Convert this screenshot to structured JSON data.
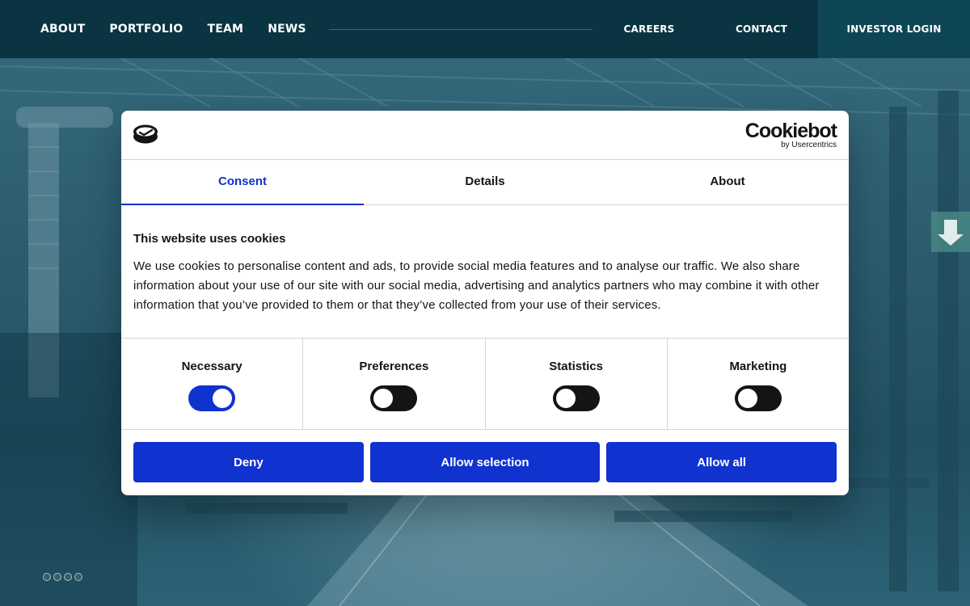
{
  "nav": {
    "left": [
      "ABOUT",
      "PORTFOLIO",
      "TEAM",
      "NEWS"
    ],
    "careers": "CAREERS",
    "contact": "CONTACT",
    "investor_login": "INVESTOR LOGIN"
  },
  "cookie": {
    "brand": "Cookiebot",
    "brand_sub": "by Usercentrics",
    "tabs": [
      "Consent",
      "Details",
      "About"
    ],
    "active_tab": "Consent",
    "title": "This website uses cookies",
    "text": "We use cookies to personalise content and ads, to provide social media features and to analyse our traffic. We also share information about your use of our site with our social media, advertising and analytics partners who may combine it with other information that you’ve provided to them or that they’ve collected from your use of their services.",
    "toggles": [
      {
        "label": "Necessary",
        "on": true
      },
      {
        "label": "Preferences",
        "on": false
      },
      {
        "label": "Statistics",
        "on": false
      },
      {
        "label": "Marketing",
        "on": false
      }
    ],
    "buttons": {
      "deny": "Deny",
      "allow_selection": "Allow selection",
      "allow_all": "Allow all"
    },
    "accent_color": "#1032cf"
  },
  "colors": {
    "nav_bg": "#0a3442",
    "investor_bg": "#0f4656"
  }
}
